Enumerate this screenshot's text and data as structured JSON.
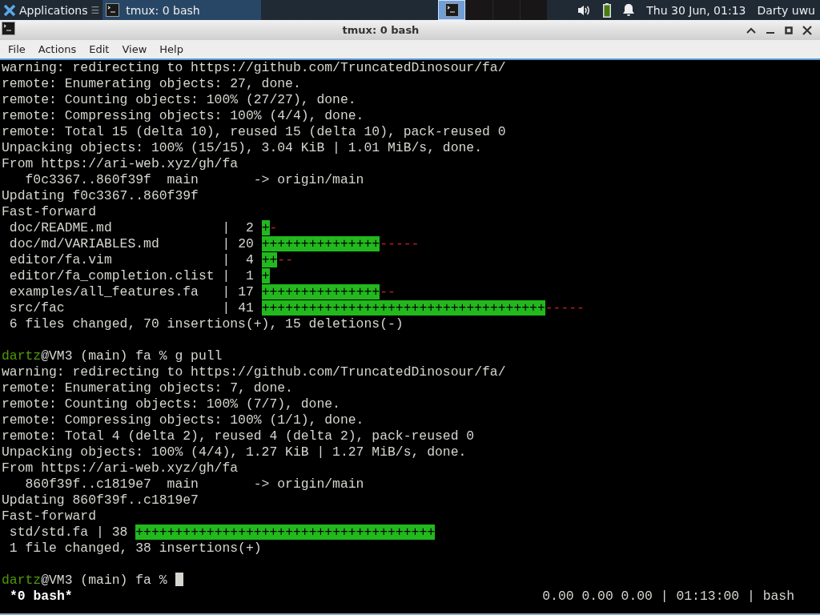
{
  "taskbar": {
    "apps_label": "Applications",
    "separator": "☰",
    "task": {
      "title": "tmux: 0 bash",
      "selected": true
    },
    "workspaces": [
      {
        "selected": true
      },
      {
        "selected": false
      },
      {
        "selected": false
      },
      {
        "selected": false
      }
    ],
    "clock": "Thu 30 Jun, 01:13",
    "user": "Darty uwu"
  },
  "window": {
    "title": "tmux: 0 bash"
  },
  "menu": [
    "File",
    "Actions",
    "Edit",
    "View",
    "Help"
  ],
  "terminal": {
    "lines": [
      {
        "kind": "text",
        "text": "warning: redirecting to https://github.com/TruncatedDinosour/fa/"
      },
      {
        "kind": "text",
        "text": "remote: Enumerating objects: 27, done."
      },
      {
        "kind": "text",
        "text": "remote: Counting objects: 100% (27/27), done."
      },
      {
        "kind": "text",
        "text": "remote: Compressing objects: 100% (4/4), done."
      },
      {
        "kind": "text",
        "text": "remote: Total 15 (delta 10), reused 15 (delta 10), pack-reused 0"
      },
      {
        "kind": "text",
        "text": "Unpacking objects: 100% (15/15), 3.04 KiB | 1.01 MiB/s, done."
      },
      {
        "kind": "text",
        "text": "From https://ari-web.xyz/gh/fa"
      },
      {
        "kind": "text",
        "text": "   f0c3367..860f39f  main       -> origin/main"
      },
      {
        "kind": "text",
        "text": "Updating f0c3367..860f39f"
      },
      {
        "kind": "text",
        "text": "Fast-forward"
      },
      {
        "kind": "diffstat",
        "rows": [
          {
            "file": "doc/README.md",
            "bar": "|",
            "count": "2",
            "plus": "+",
            "minus": "-"
          },
          {
            "file": "doc/md/VARIABLES.md",
            "bar": "|",
            "count": "20",
            "plus": "+++++++++++++++",
            "minus": "-----"
          },
          {
            "file": "editor/fa.vim",
            "bar": "|",
            "count": "4",
            "plus": "++",
            "minus": "--"
          },
          {
            "file": "editor/fa_completion.clist",
            "bar": "|",
            "count": "1",
            "plus": "+",
            "minus": ""
          },
          {
            "file": "examples/all_features.fa",
            "bar": "|",
            "count": "17",
            "plus": "+++++++++++++++",
            "minus": "--"
          },
          {
            "file": "src/fac",
            "bar": "|",
            "count": "41",
            "plus": "++++++++++++++++++++++++++++++++++++",
            "minus": "-----"
          }
        ]
      },
      {
        "kind": "text",
        "text": " 6 files changed, 70 insertions(+), 15 deletions(-)"
      },
      {
        "kind": "blank"
      },
      {
        "kind": "prompt",
        "user": "dartz",
        "rest": "@VM3 (main) fa % g pull",
        "cursor": false
      },
      {
        "kind": "text",
        "text": "warning: redirecting to https://github.com/TruncatedDinosour/fa/"
      },
      {
        "kind": "text",
        "text": "remote: Enumerating objects: 7, done."
      },
      {
        "kind": "text",
        "text": "remote: Counting objects: 100% (7/7), done."
      },
      {
        "kind": "text",
        "text": "remote: Compressing objects: 100% (1/1), done."
      },
      {
        "kind": "text",
        "text": "remote: Total 4 (delta 2), reused 4 (delta 2), pack-reused 0"
      },
      {
        "kind": "text",
        "text": "Unpacking objects: 100% (4/4), 1.27 KiB | 1.27 MiB/s, done."
      },
      {
        "kind": "text",
        "text": "From https://ari-web.xyz/gh/fa"
      },
      {
        "kind": "text",
        "text": "   860f39f..c1819e7  main       -> origin/main"
      },
      {
        "kind": "text",
        "text": "Updating 860f39f..c1819e7"
      },
      {
        "kind": "text",
        "text": "Fast-forward"
      },
      {
        "kind": "diffstat",
        "rows": [
          {
            "file": "std/std.fa",
            "bar": "|",
            "count": "38",
            "plus": "++++++++++++++++++++++++++++++++++++++",
            "minus": ""
          }
        ]
      },
      {
        "kind": "text",
        "text": " 1 file changed, 38 insertions(+)"
      },
      {
        "kind": "blank"
      },
      {
        "kind": "prompt",
        "user": "dartz",
        "rest": "@VM3 (main) fa %",
        "cursor": true
      }
    ]
  },
  "status_bar": {
    "window": "*0 bash*",
    "right": "0.00 0.00 0.00 | 01:13:00 | bash"
  }
}
